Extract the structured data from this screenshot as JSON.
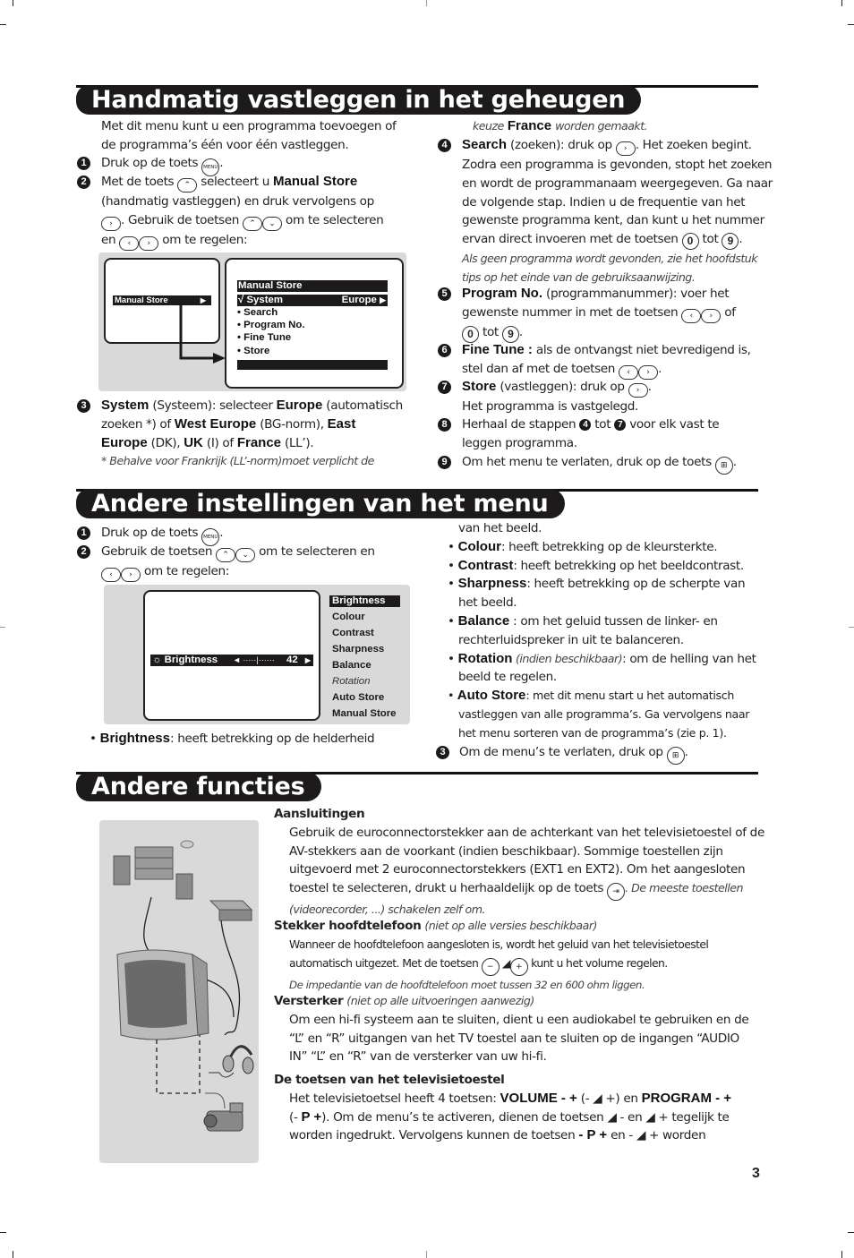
{
  "page_number": "3",
  "sections": {
    "manual_store": {
      "title": "Handmatig vastleggen in het geheugen",
      "intro": [
        "Met dit menu kunt u een programma toevoegen of",
        "de programma’s één voor één vastleggen."
      ],
      "step1": {
        "num": "1",
        "text": "Druk op de toets",
        "key": "MENU"
      },
      "step2": {
        "num": "2",
        "l1_a": "Met de toets",
        "l1_b": "selecteert u",
        "l1_bold": "Manual Store",
        "l2": "(handmatig vastleggen) en druk vervolgens op",
        "l3_a": ". Gebruik de toetsen",
        "l3_b": "om te selecteren",
        "l4_a": "en",
        "l4_b": "om te regelen:"
      },
      "diagram": {
        "left_screen_item": "Manual Store",
        "right_screen_title": "Manual Store",
        "right_screen_items": [
          {
            "marker": "√",
            "label": "System",
            "value": "Europe",
            "selected": true
          },
          {
            "marker": "•",
            "label": "Search"
          },
          {
            "marker": "•",
            "label": "Program No."
          },
          {
            "marker": "•",
            "label": "Fine Tune"
          },
          {
            "marker": "•",
            "label": "Store"
          }
        ]
      },
      "step3": {
        "num": "3",
        "b1": "System",
        "t1": "(Systeem): selecteer",
        "b2": "Europe",
        "t2": "(automatisch",
        "t3": "zoeken *) of",
        "b3": "West Europe",
        "t4": "(BG-norm),",
        "b4": "East",
        "b5": "Europe",
        "t5": "(DK),",
        "b6": "UK",
        "t6": "(I) of",
        "b7": "France",
        "t7": "(LL’).",
        "note": "* Behalve voor Frankrijk (LL’-norm)moet verplicht de",
        "note2_a": "keuze",
        "note2_b": "France",
        "note2_c": "worden gemaakt."
      },
      "step4": {
        "num": "4",
        "bold": "Search",
        "t1": "(zoeken): druk op",
        "t2": ". Het zoeken begint.",
        "lines": [
          "Zodra een programma is gevonden, stopt het zoeken",
          "en wordt de programmanaam weergegeven. Ga naar",
          "de volgende stap. Indien u de frequentie van het",
          "gewenste programma kent, dan kunt u het nummer"
        ],
        "last_a": "ervan direct invoeren met de toetsen",
        "last_b": "tot",
        "key0": "0",
        "key9": "9",
        "note": [
          "Als geen programma wordt gevonden, zie het hoofdstuk",
          "tips op het einde van de gebruiksaanwijzing."
        ]
      },
      "step5": {
        "num": "5",
        "bold": "Program No.",
        "t1": "(programmanummer): voer het",
        "t2": "gewenste nummer in met de toetsen",
        "t3": "of",
        "t4": "tot",
        "key0": "0",
        "key9": "9"
      },
      "step6": {
        "num": "6",
        "bold": "Fine Tune :",
        "t1": "als de ontvangst niet bevredigend is,",
        "t2": "stel dan af met de toetsen"
      },
      "step7": {
        "num": "7",
        "bold": "Store",
        "t1": "(vastleggen): druk op",
        "t2": "Het programma is vastgelegd."
      },
      "step8": {
        "num": "8",
        "t1": "Herhaal de stappen",
        "ref_a": "4",
        "t2": "tot",
        "ref_b": "7",
        "t3": "voor elk vast te",
        "t4": "leggen programma."
      },
      "step9": {
        "num": "9",
        "t1": "Om het menu te verlaten, druk op de toets"
      }
    },
    "other_settings": {
      "title": "Andere instellingen van het menu",
      "step1": {
        "num": "1",
        "text": "Druk op de toets",
        "key": "MENU"
      },
      "step2": {
        "num": "2",
        "t1": "Gebruik de toetsen",
        "t2": "om te selecteren en",
        "t3": "om te regelen:"
      },
      "osd": {
        "label": "Brightness",
        "scale": "◄ ·····|······",
        "value": 42,
        "menu_items": [
          "Brightness",
          "Colour",
          "Contrast",
          "Sharpness",
          "Balance",
          "Rotation",
          "Auto Store",
          "Manual Store"
        ],
        "selected_item": "Brightness",
        "italic_item": "Rotation"
      },
      "bullets": [
        {
          "bold": "Brightness",
          "text": ": heeft betrekking op de helderheid"
        },
        {
          "bold": "",
          "text": "van het beeld."
        },
        {
          "bold": "Colour",
          "text": ": heeft betrekking op de kleursterkte."
        },
        {
          "bold": "Contrast",
          "text": ": heeft betrekking op het beeldcontrast."
        },
        {
          "bold": "Sharpness",
          "text": ": heeft betrekking op de scherpte van"
        },
        {
          "bold": "",
          "text": "het beeld."
        },
        {
          "bold": "Balance",
          "text": " : om het geluid tussen de linker- en"
        },
        {
          "bold": "",
          "text": "rechterluidspreker in uit te balanceren."
        },
        {
          "bold": "Rotation",
          "italic": " (indien beschikbaar)",
          "text": ": om de helling van het"
        },
        {
          "bold": "",
          "text": "beeld te regelen."
        },
        {
          "bold": "Auto Store",
          "text": ": met dit menu start u het automatisch"
        },
        {
          "bold": "",
          "text": "vastleggen van alle programma’s. Ga vervolgens naar"
        },
        {
          "bold": "",
          "text": "het menu sorteren van de programma’s (zie p. 1)."
        }
      ],
      "step3": {
        "num": "3",
        "t1": "Om de menu’s te verlaten, druk op"
      }
    },
    "other_functions": {
      "title": "Andere functies",
      "connections": {
        "heading": "Aansluitingen",
        "lines": [
          "Gebruik de euroconnectorstekker aan de achterkant van het televisietoestel of de",
          "AV-stekkers aan de voorkant (indien beschikbaar). Sommige toestellen zijn",
          "uitgevoerd met 2 euroconnectorstekkers (EXT1 en EXT2). Om het aangesloten"
        ],
        "last_a": "toestel te selecteren, drukt u herhaaldelijk op de toets",
        "last_italic": ". De meeste toestellen",
        "last_line": "(videorecorder, ...) schakelen zelf om."
      },
      "headphones": {
        "heading": "Stekker hoofdtelefoon",
        "heading_note": "(niet op alle versies beschikbaar)",
        "l1": "Wanneer de hoofdtelefoon aangesloten is, wordt het geluid van het televisietoestel",
        "l2_a": "automatisch uitgezet. Met de toetsen",
        "l2_b": "kunt u het volume regelen.",
        "note": "De impedantie van de hoofdtelefoon moet tussen 32 en 600 ohm liggen."
      },
      "amplifier": {
        "heading": "Versterker",
        "heading_note": "(niet op alle uitvoeringen aanwezig)",
        "lines": [
          "Om een hi-fi systeem aan te sluiten, dient u een audiokabel te gebruiken en de",
          "“L” en “R” uitgangen van het TV toestel aan te sluiten op de ingangen “AUDIO",
          "IN” “L” en “R” van de versterker van uw hi-fi."
        ]
      },
      "tv_keys": {
        "heading": "De toetsen van het televisietoestel",
        "l1_a": "Het televisietoetsel heeft 4 toetsen:",
        "l1_b": "VOLUME - +",
        "l1_c": "(-",
        "l1_d": "+) en",
        "l1_e": "PROGRAM - +",
        "l2_a": "(-",
        "l2_b": "P +",
        "l2_c": "). Om de menu’s te activeren, dienen de toetsen",
        "l2_d": "- en",
        "l2_e": "+ tegelijk te",
        "l3_a": "worden ingedrukt. Vervolgens kunnen de toetsen",
        "l3_b": "- P +",
        "l3_c": "en -",
        "l3_d": "+ worden"
      }
    }
  }
}
